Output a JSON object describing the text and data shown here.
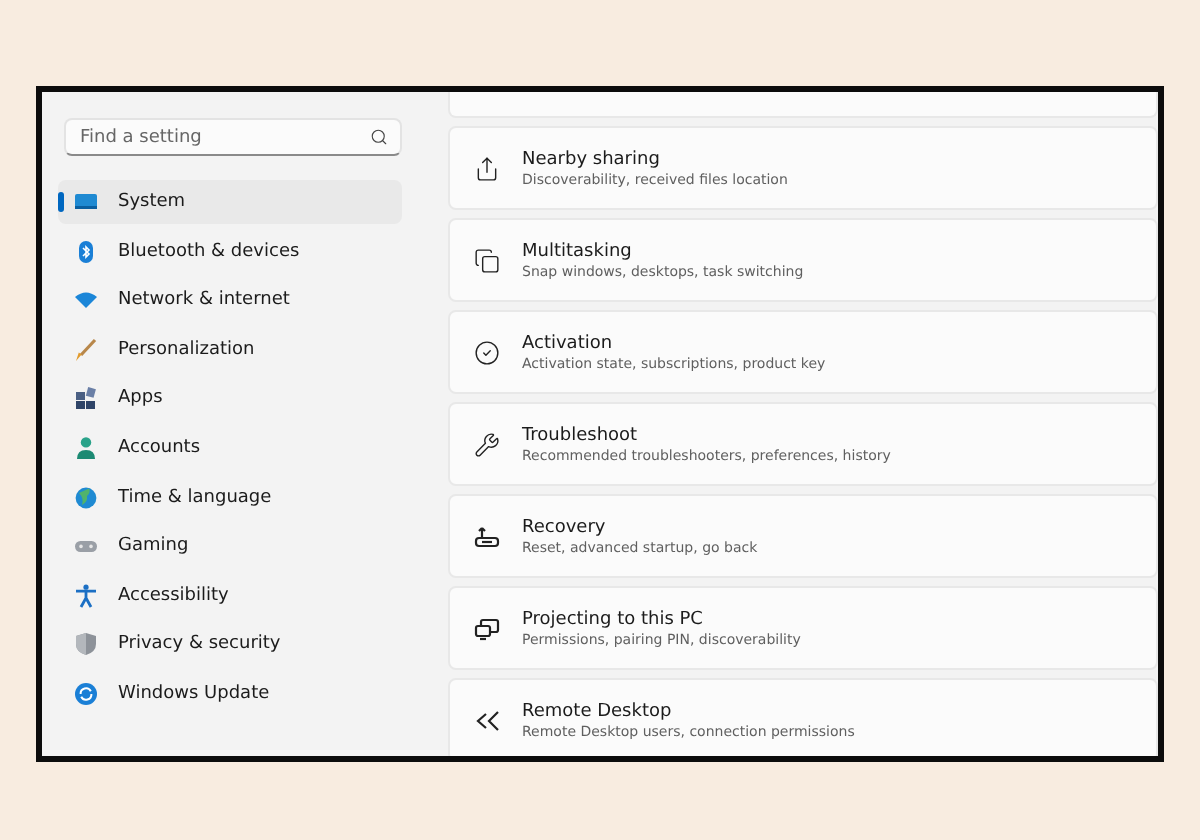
{
  "sidebar": {
    "search": {
      "placeholder": "Find a setting"
    },
    "items": [
      {
        "label": "System",
        "kind": "system",
        "selected": true
      },
      {
        "label": "Bluetooth & devices",
        "kind": "bluetooth",
        "selected": false
      },
      {
        "label": "Network & internet",
        "kind": "network",
        "selected": false
      },
      {
        "label": "Personalization",
        "kind": "brush",
        "selected": false
      },
      {
        "label": "Apps",
        "kind": "apps",
        "selected": false
      },
      {
        "label": "Accounts",
        "kind": "accounts",
        "selected": false
      },
      {
        "label": "Time & language",
        "kind": "globe",
        "selected": false
      },
      {
        "label": "Gaming",
        "kind": "gaming",
        "selected": false
      },
      {
        "label": "Accessibility",
        "kind": "accessibility",
        "selected": false
      },
      {
        "label": "Privacy & security",
        "kind": "shield",
        "selected": false
      },
      {
        "label": "Windows Update",
        "kind": "update",
        "selected": false
      }
    ]
  },
  "settings": [
    {
      "title": "Nearby sharing",
      "description": "Discoverability, received files location",
      "kind": "share"
    },
    {
      "title": "Multitasking",
      "description": "Snap windows, desktops, task switching",
      "kind": "multitask"
    },
    {
      "title": "Activation",
      "description": "Activation state, subscriptions, product key",
      "kind": "check"
    },
    {
      "title": "Troubleshoot",
      "description": "Recommended troubleshooters, preferences, history",
      "kind": "wrench"
    },
    {
      "title": "Recovery",
      "description": "Reset, advanced startup, go back",
      "kind": "recovery"
    },
    {
      "title": "Projecting to this PC",
      "description": "Permissions, pairing PIN, discoverability",
      "kind": "project"
    },
    {
      "title": "Remote Desktop",
      "description": "Remote Desktop users, connection permissions",
      "kind": "remote"
    }
  ]
}
